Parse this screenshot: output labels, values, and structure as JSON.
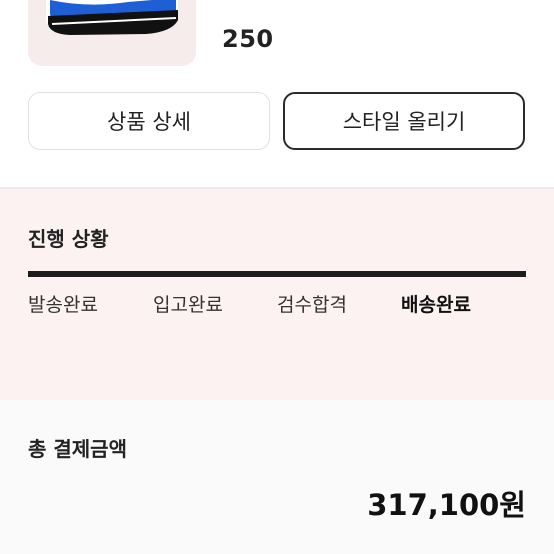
{
  "product": {
    "size": "250",
    "image_icon": "sneaker-image"
  },
  "actions": {
    "detail_label": "상품 상세",
    "style_label": "스타일 올리기"
  },
  "progress": {
    "title": "진행 상황",
    "steps": [
      {
        "label": "발송완료",
        "active": false
      },
      {
        "label": "입고완료",
        "active": false
      },
      {
        "label": "검수합격",
        "active": false
      },
      {
        "label": "배송완료",
        "active": true
      }
    ],
    "completion": 1.0
  },
  "payment": {
    "title": "총 결제금액",
    "amount": "317,100원"
  },
  "colors": {
    "progress_bg": "#fdf2f2",
    "thumb_bg": "#f6ecec",
    "bar_fill": "#1c1c1c",
    "sneaker_blue": "#1f5fd6"
  }
}
